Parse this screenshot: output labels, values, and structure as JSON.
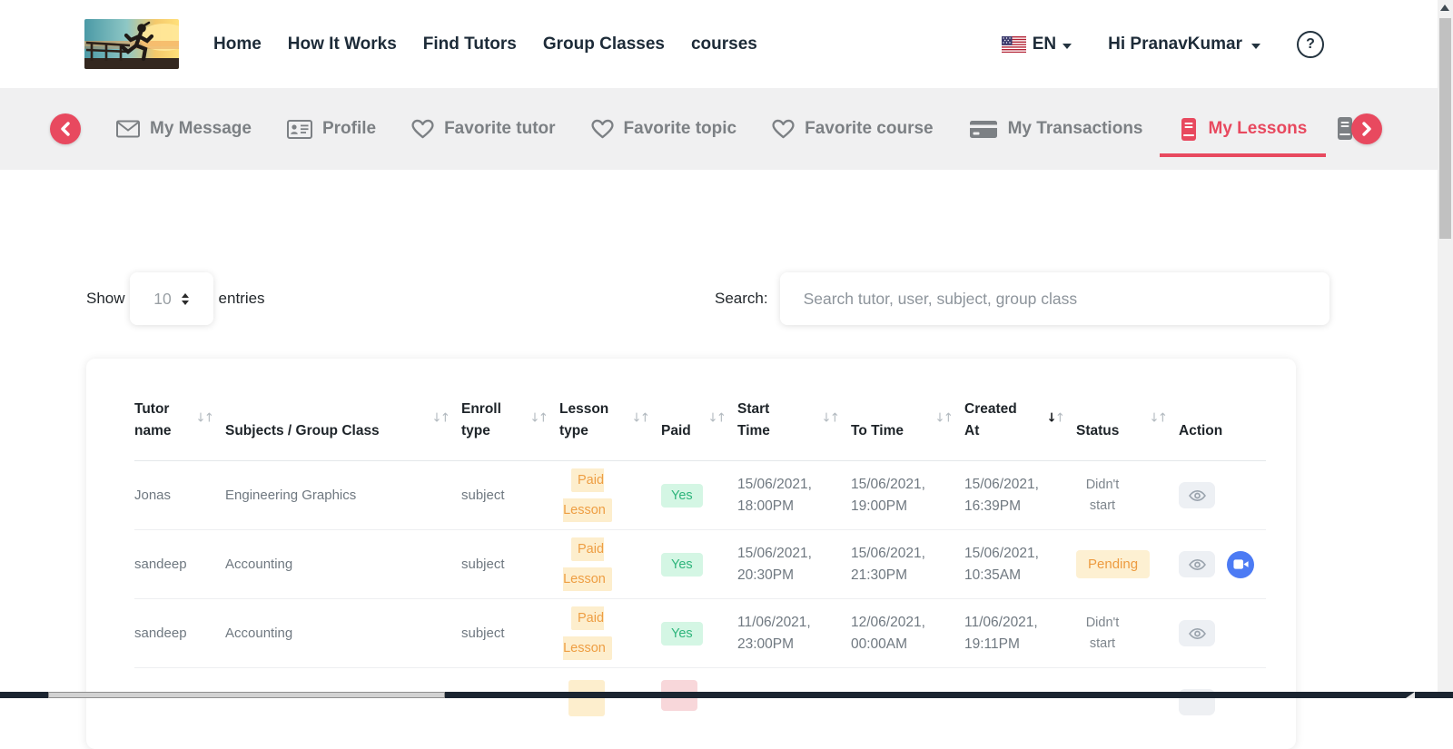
{
  "navbar": {
    "links": [
      {
        "label": "Home"
      },
      {
        "label": "How It Works"
      },
      {
        "label": "Find Tutors"
      },
      {
        "label": "Group Classes"
      },
      {
        "label": "courses"
      }
    ],
    "language": "EN",
    "greeting": "Hi PranavKumar"
  },
  "tabbar": {
    "items": [
      {
        "label": "My Message",
        "icon": "envelope-icon"
      },
      {
        "label": "Profile",
        "icon": "id-card-icon"
      },
      {
        "label": "Favorite tutor",
        "icon": "heart-icon"
      },
      {
        "label": "Favorite topic",
        "icon": "heart-icon"
      },
      {
        "label": "Favorite course",
        "icon": "heart-icon"
      },
      {
        "label": "My Transactions",
        "icon": "credit-card-icon"
      },
      {
        "label": "My Lessons",
        "icon": "book-icon",
        "active": true
      }
    ]
  },
  "controls": {
    "show_label": "Show",
    "page_size": "10",
    "entries_label": "entries",
    "search_label": "Search:",
    "search_placeholder": "Search tutor, user, subject, group class",
    "search_value": ""
  },
  "table": {
    "columns": [
      {
        "label": "Tutor name",
        "sortable": true
      },
      {
        "label": "Subjects / Group Class",
        "sortable": true
      },
      {
        "label": "Enroll type",
        "sortable": true
      },
      {
        "label": "Lesson type",
        "sortable": true
      },
      {
        "label": "Paid",
        "sortable": true
      },
      {
        "label": "Start Time",
        "sortable": true
      },
      {
        "label": "To Time",
        "sortable": true
      },
      {
        "label": "Created At",
        "sortable": true,
        "sorted": "desc"
      },
      {
        "label": "Status",
        "sortable": true
      },
      {
        "label": "Action",
        "sortable": false
      }
    ],
    "rows": [
      {
        "tutor": "Jonas",
        "subject": "Engineering Graphics",
        "enroll_type": "subject",
        "lesson_type": "Paid Lesson",
        "paid": "Yes",
        "start_time": "15/06/2021, 18:00PM",
        "to_time": "15/06/2021, 19:00PM",
        "created_at": "15/06/2021, 16:39PM",
        "status": "Didn't start"
      },
      {
        "tutor": "sandeep",
        "subject": "Accounting",
        "enroll_type": "subject",
        "lesson_type": "Paid Lesson",
        "paid": "Yes",
        "start_time": "15/06/2021, 20:30PM",
        "to_time": "15/06/2021, 21:30PM",
        "created_at": "15/06/2021, 10:35AM",
        "status": "Pending"
      },
      {
        "tutor": "sandeep",
        "subject": "Accounting",
        "enroll_type": "subject",
        "lesson_type": "Paid Lesson",
        "paid": "Yes",
        "start_time": "11/06/2021, 23:00PM",
        "to_time": "12/06/2021, 00:00AM",
        "created_at": "11/06/2021, 19:11PM",
        "status": "Didn't start"
      }
    ]
  },
  "colors": {
    "accent_red": "#e8495f",
    "tabbar_bg": "#f0f0f1",
    "badge_yellow_bg": "#fdeecd",
    "badge_yellow_text": "#ee9e43",
    "badge_green_bg": "#d4f6e4",
    "badge_green_text": "#2fb57c",
    "badge_pending_bg": "#fdf0d2",
    "badge_pink_bg": "#f8d7da",
    "eye_button_bg": "#edf0f4",
    "video_button_bg": "#4c7bf4",
    "hscroll_track": "#1b2531"
  }
}
